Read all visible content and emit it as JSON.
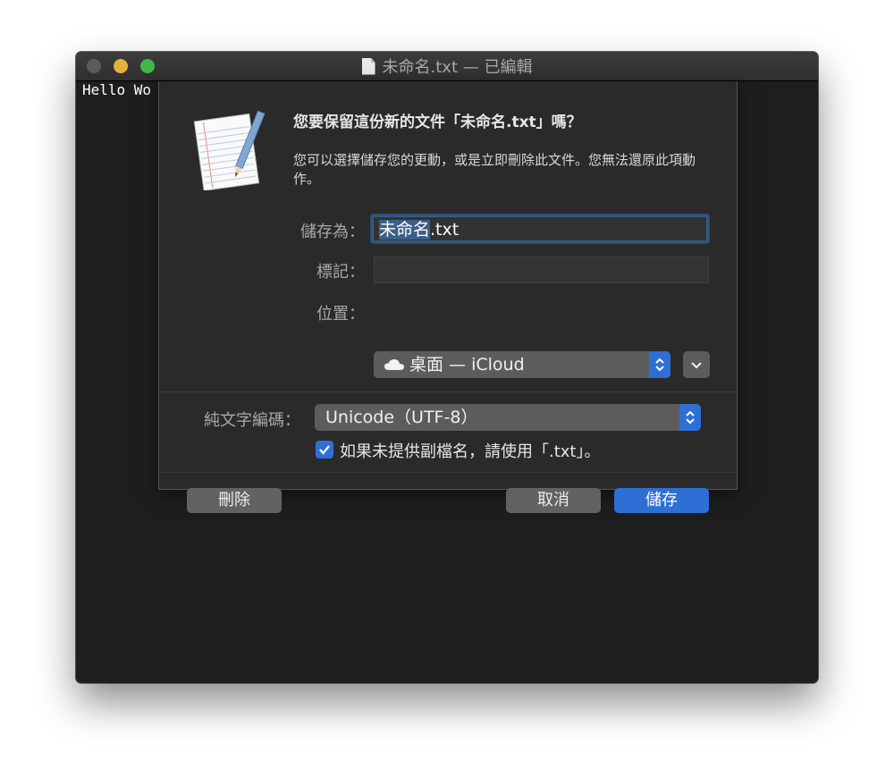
{
  "window": {
    "title": "未命名.txt — 已編輯",
    "editor_text": "Hello Wo"
  },
  "dialog": {
    "app_icon": "textedit-icon",
    "heading": "您要保留這份新的文件「未命名.txt」嗎？",
    "message": "您可以選擇儲存您的更動，或是立即刪除此文件。您無法還原此項動作。",
    "save_as_label": "儲存為：",
    "filename_selected": "未命名",
    "filename_rest": ".txt",
    "tags_label": "標記：",
    "tags_value": "",
    "location_label": "位置：",
    "location_value": "桌面 — iCloud",
    "encoding_label": "純文字編碼：",
    "encoding_value": "Unicode（UTF-8）",
    "extension_checkbox_label": "如果未提供副檔名，請使用「.txt」。",
    "extension_checkbox_checked": true,
    "delete_button": "刪除",
    "cancel_button": "取消",
    "save_button": "儲存"
  },
  "colors": {
    "accent": "#2e6fd6",
    "window_background": "#1e1e1e",
    "sheet_background": "#2a2a2a",
    "traffic_minimize": "#e3b23c",
    "traffic_maximize": "#3fb94a"
  }
}
